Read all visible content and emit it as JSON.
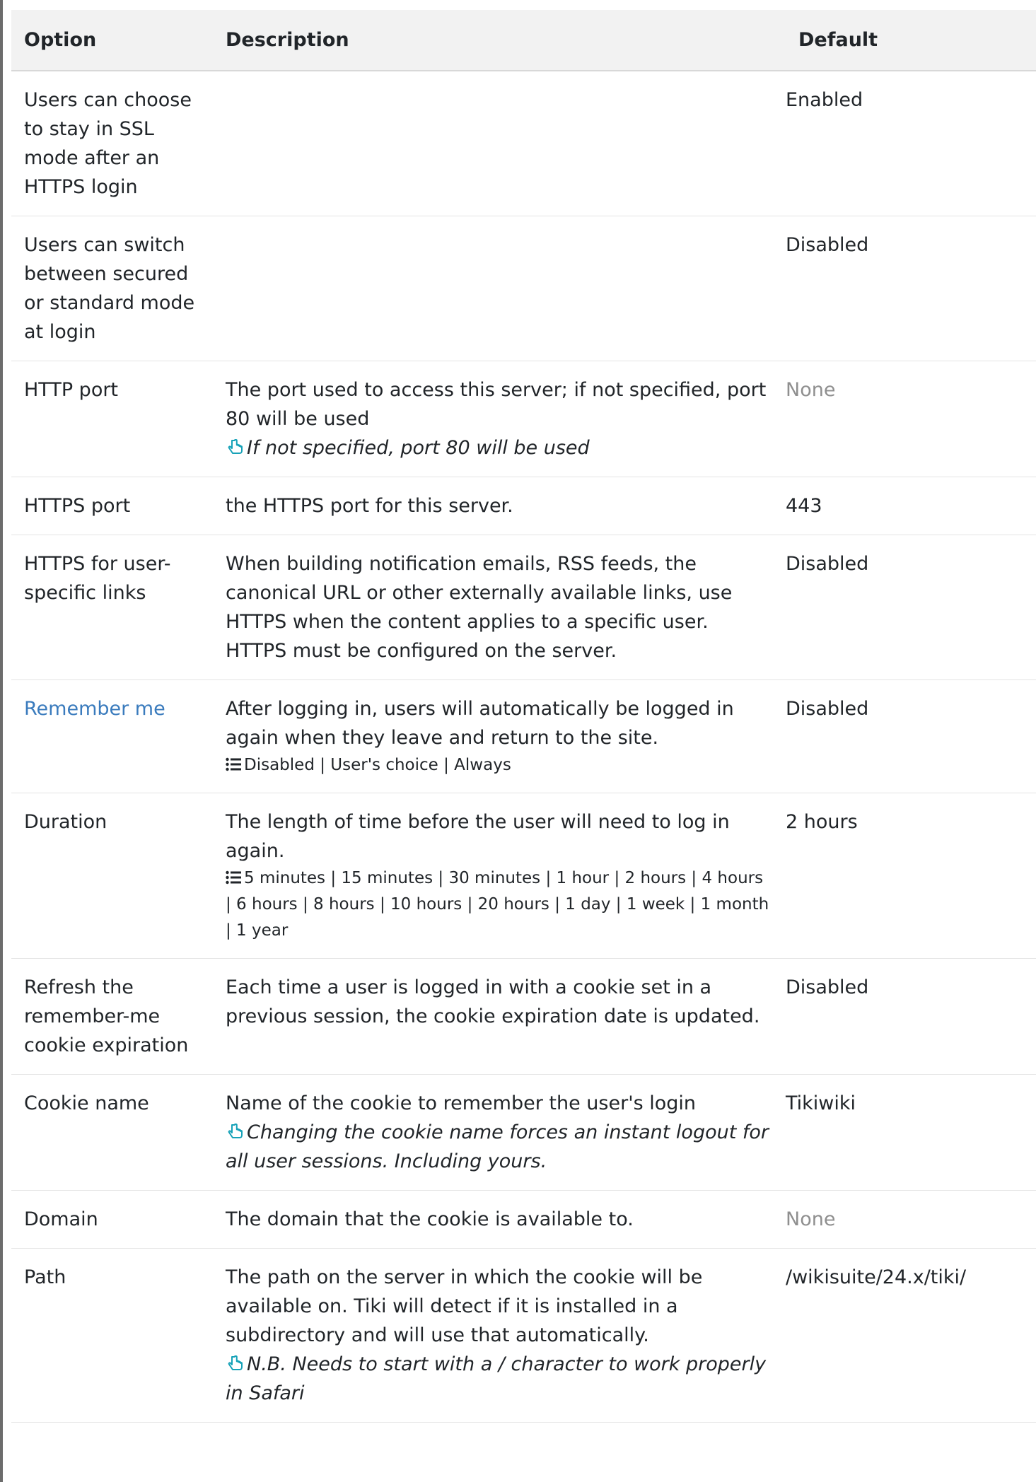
{
  "table": {
    "headers": {
      "option": "Option",
      "description": "Description",
      "default": "Default"
    },
    "rows": [
      {
        "option": "Users can choose to stay in SSL mode after an HTTPS login",
        "description": "",
        "default": "Enabled"
      },
      {
        "option": "Users can switch between secured or standard mode at login",
        "description": "",
        "default": "Disabled"
      },
      {
        "option": "HTTP port",
        "description": "The port used to access this server; if not specified, port 80 will be used",
        "hint": "If not specified, port 80 will be used",
        "default": "None"
      },
      {
        "option": "HTTPS port",
        "description": "the HTTPS port for this server.",
        "default": "443"
      },
      {
        "option": "HTTPS for user-specific links",
        "description": "When building notification emails, RSS feeds, the canonical URL or other externally available links, use HTTPS when the content applies to a specific user. HTTPS must be configured on the server.",
        "default": "Disabled"
      },
      {
        "option": "Remember me",
        "description": "After logging in, users will automatically be logged in again when they leave and return to the site.",
        "options": "Disabled | User's choice | Always",
        "default": "Disabled"
      },
      {
        "option": "Duration",
        "description": "The length of time before the user will need to log in again.",
        "options": "5 minutes | 15 minutes | 30 minutes | 1 hour | 2 hours | 4 hours | 6 hours | 8 hours | 10 hours | 20 hours | 1 day | 1 week | 1 month | 1 year",
        "default": "2 hours"
      },
      {
        "option": "Refresh the remember-me cookie expiration",
        "description": "Each time a user is logged in with a cookie set in a previous session, the cookie expiration date is updated.",
        "default": "Disabled"
      },
      {
        "option": "Cookie name",
        "description": "Name of the cookie to remember the user's login",
        "hint": "Changing the cookie name forces an instant logout for all user sessions. Including yours.",
        "default": "Tikiwiki"
      },
      {
        "option": "Domain",
        "description": "The domain that the cookie is available to.",
        "default": "None"
      },
      {
        "option": "Path",
        "description": "The path on the server in which the cookie will be available on. Tiki will detect if it is installed in a subdirectory and will use that automatically.",
        "hint": "N.B. Needs to start with a / character to work properly in Safari",
        "default": "/wikisuite/24.x/tiki/"
      }
    ]
  },
  "colors": {
    "link": "#3a7bbd",
    "muted": "#8f8f8f",
    "hint_icon": "#17a2b8",
    "header_bg": "#f2f2f2"
  },
  "icons": {
    "hint": "pointing-hand-icon",
    "options": "list-icon"
  }
}
